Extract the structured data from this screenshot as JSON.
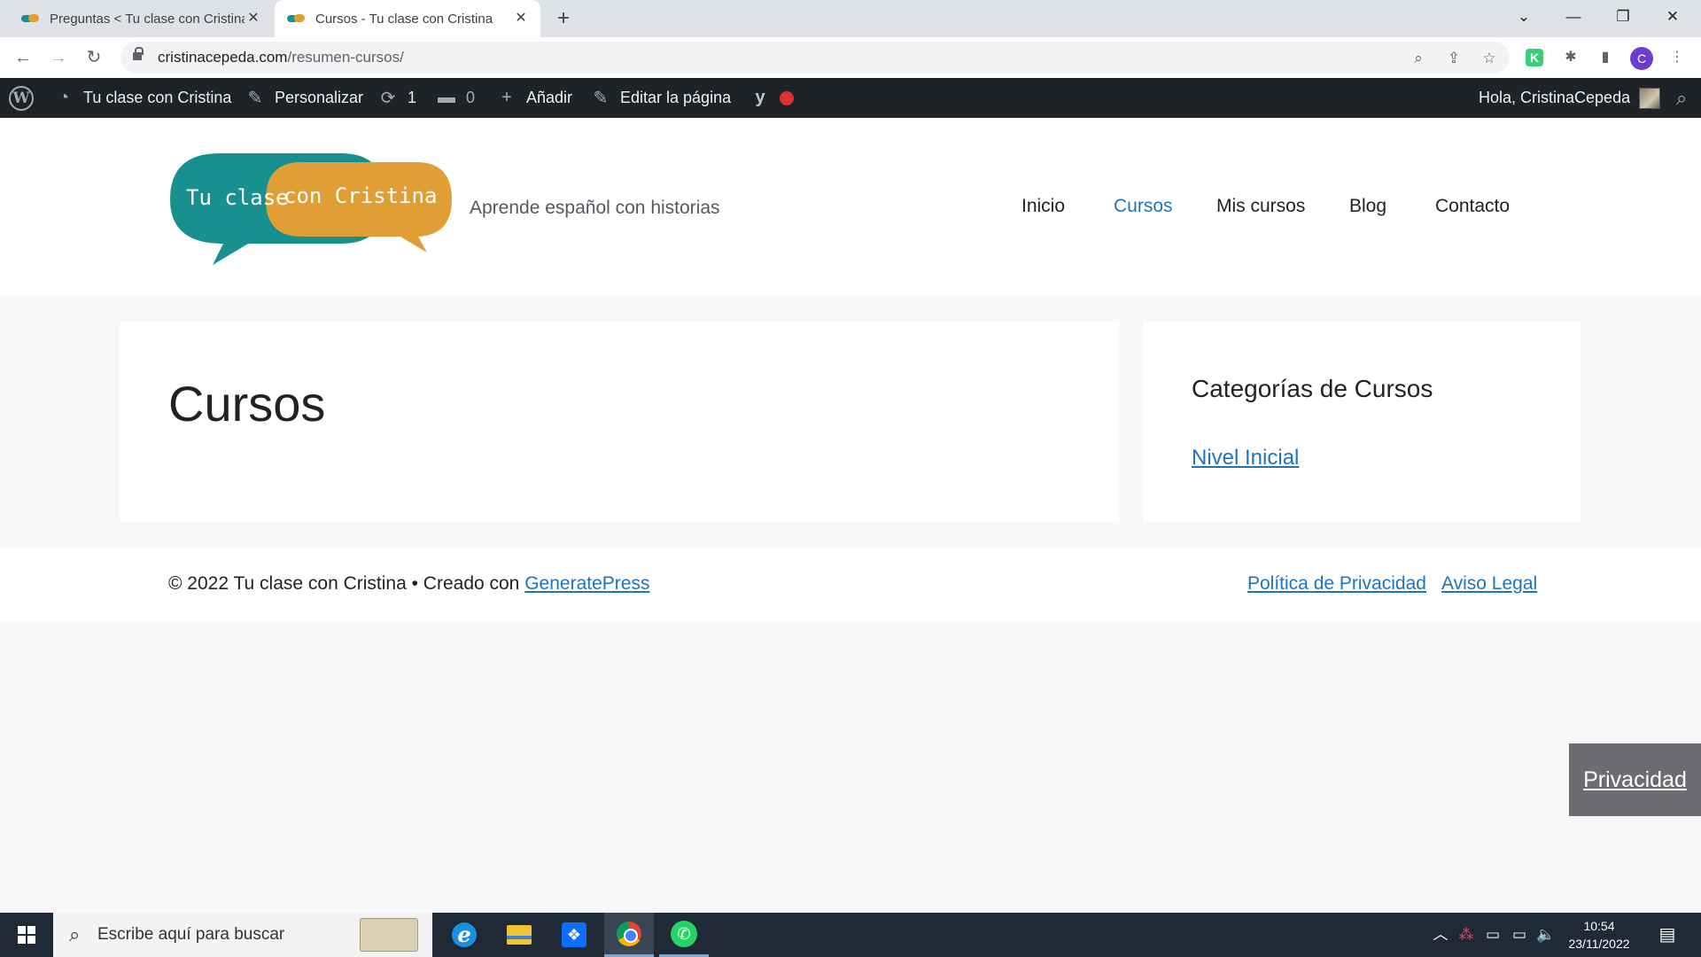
{
  "browser": {
    "tabs": [
      {
        "title": "Preguntas < Tu clase con Cristina",
        "close": "✕"
      },
      {
        "title": "Cursos - Tu clase con Cristina",
        "close": "✕"
      }
    ],
    "new_tab": "+",
    "window_controls": {
      "dropdown": "⌄",
      "minimize": "—",
      "restore": "❐",
      "close": "✕"
    },
    "nav": {
      "back": "←",
      "forward": "→",
      "reload": "↻"
    },
    "url": {
      "domain": "cristinacepeda.com",
      "path": "/resumen-cursos/"
    },
    "omnibox_icons": {
      "zoom": "⌕",
      "share": "⇪",
      "bookmark": "☆"
    },
    "extensions": {
      "k": "K",
      "puzzle": "✱",
      "sidepanel": "▮",
      "menu": "⋮"
    },
    "profile_initial": "C"
  },
  "adminbar": {
    "site_name": "Tu clase con Cristina",
    "customize": "Personalizar",
    "updates_count": "1",
    "comments_count": "0",
    "add_new": "Añadir",
    "edit_page": "Editar la página",
    "greeting": "Hola, CristinaCepeda",
    "icons": {
      "wp": "W",
      "dashboard": "◔",
      "brush": "✎",
      "updates": "⟳",
      "comments": "▬",
      "plus": "+",
      "pencil": "✎",
      "yoast": "y",
      "search": "⌕"
    }
  },
  "site": {
    "logo_text_left": "Tu clase",
    "logo_text_right": "con Cristina",
    "tagline": "Aprende español con historias",
    "nav": [
      "Inicio",
      "Cursos",
      "Mis cursos",
      "Blog",
      "Contacto"
    ],
    "active_nav": "Cursos",
    "colors": {
      "teal": "#17908f",
      "orange": "#e19e34",
      "link": "#1e73be"
    }
  },
  "content": {
    "page_title": "Cursos"
  },
  "sidebar": {
    "widget_title": "Categorías de Cursos",
    "link": "Nivel Inicial"
  },
  "footer": {
    "copyright_prefix": "© 2022 Tu clase con Cristina • Creado con ",
    "generator_link": "GeneratePress",
    "privacy_link": "Política de Privacidad",
    "legal_link": "Aviso Legal"
  },
  "privacy_button": "Privacidad",
  "taskbar": {
    "search_placeholder": "Escribe aquí para buscar",
    "search_icon": "⌕",
    "apps": {
      "ie": "e",
      "dropbox": "❖",
      "whatsapp": "✆"
    },
    "tray": {
      "chevron": "︿",
      "app": "⁂",
      "battery": "▭",
      "network": "▭",
      "volume": "🔈",
      "notifications": "▤"
    },
    "time": "10:54",
    "date": "23/11/2022"
  }
}
